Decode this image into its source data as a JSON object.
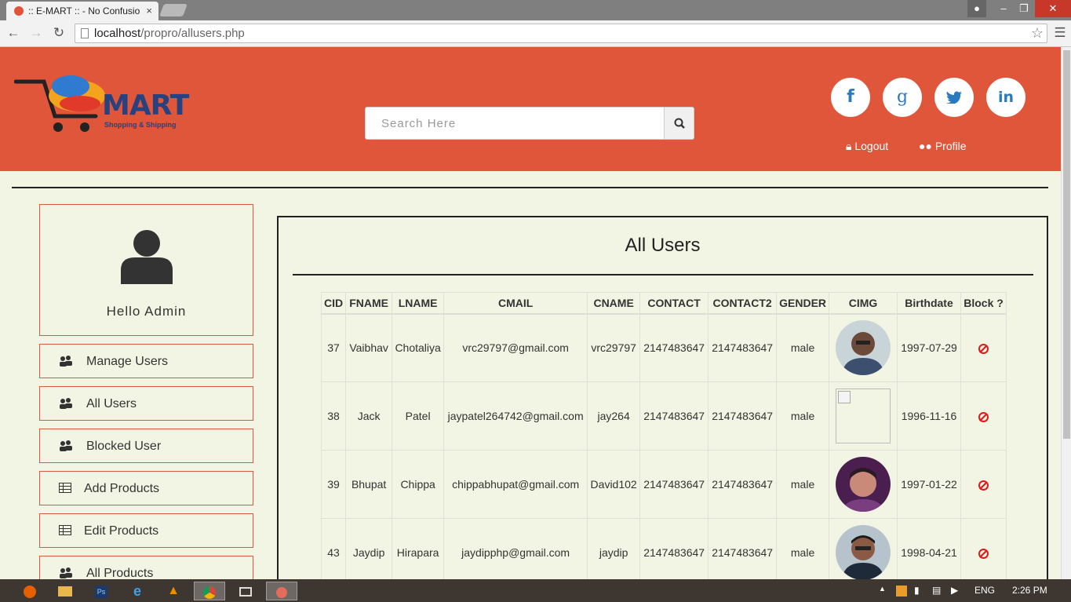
{
  "browser": {
    "tab_title": ":: E-MART :: - No Confusio",
    "url_host": "localhost",
    "url_path": "/propro/allusers.php"
  },
  "header": {
    "logo_text": "MART",
    "logo_tagline": "Shopping & Shipping",
    "search_placeholder": "Search Here",
    "social": [
      "f",
      "g",
      "t",
      "in"
    ],
    "logout_label": "Logout",
    "profile_label": "Profile",
    "brand_color": "#df563a"
  },
  "sidebar": {
    "greeting": "Hello Admin",
    "items": [
      {
        "label": "Manage Users",
        "icon": "users-icon"
      },
      {
        "label": "All Users",
        "icon": "users-icon"
      },
      {
        "label": "Blocked User",
        "icon": "users-icon"
      },
      {
        "label": "Add Products",
        "icon": "table-icon"
      },
      {
        "label": "Edit Products",
        "icon": "table-icon"
      },
      {
        "label": "All Products",
        "icon": "users-icon"
      }
    ]
  },
  "main": {
    "title": "All Users",
    "columns": [
      "CID",
      "FNAME",
      "LNAME",
      "CMAIL",
      "CNAME",
      "CONTACT",
      "CONTACT2",
      "GENDER",
      "CIMG",
      "Birthdate",
      "Block ?"
    ],
    "rows": [
      {
        "cid": "37",
        "fname": "Vaibhav",
        "lname": "Chotaliya",
        "cmail": "vrc29797@gmail.com",
        "cname": "vrc29797",
        "contact": "2147483647",
        "contact2": "2147483647",
        "gender": "male",
        "img": "photo",
        "birthdate": "1997-07-29"
      },
      {
        "cid": "38",
        "fname": "Jack",
        "lname": "Patel",
        "cmail": "jaypatel264742@gmail.com",
        "cname": "jay264",
        "contact": "2147483647",
        "contact2": "2147483647",
        "gender": "male",
        "img": "broken",
        "birthdate": "1996-11-16"
      },
      {
        "cid": "39",
        "fname": "Bhupat",
        "lname": "Chippa",
        "cmail": "chippabhupat@gmail.com",
        "cname": "David102",
        "contact": "2147483647",
        "contact2": "2147483647",
        "gender": "male",
        "img": "photo",
        "birthdate": "1997-01-22"
      },
      {
        "cid": "43",
        "fname": "Jaydip",
        "lname": "Hirapara",
        "cmail": "jaydipphp@gmail.com",
        "cname": "jaydip",
        "contact": "2147483647",
        "contact2": "2147483647",
        "gender": "male",
        "img": "photo",
        "birthdate": "1998-04-21"
      }
    ]
  },
  "taskbar": {
    "lang": "ENG",
    "time": "2:26 PM"
  }
}
